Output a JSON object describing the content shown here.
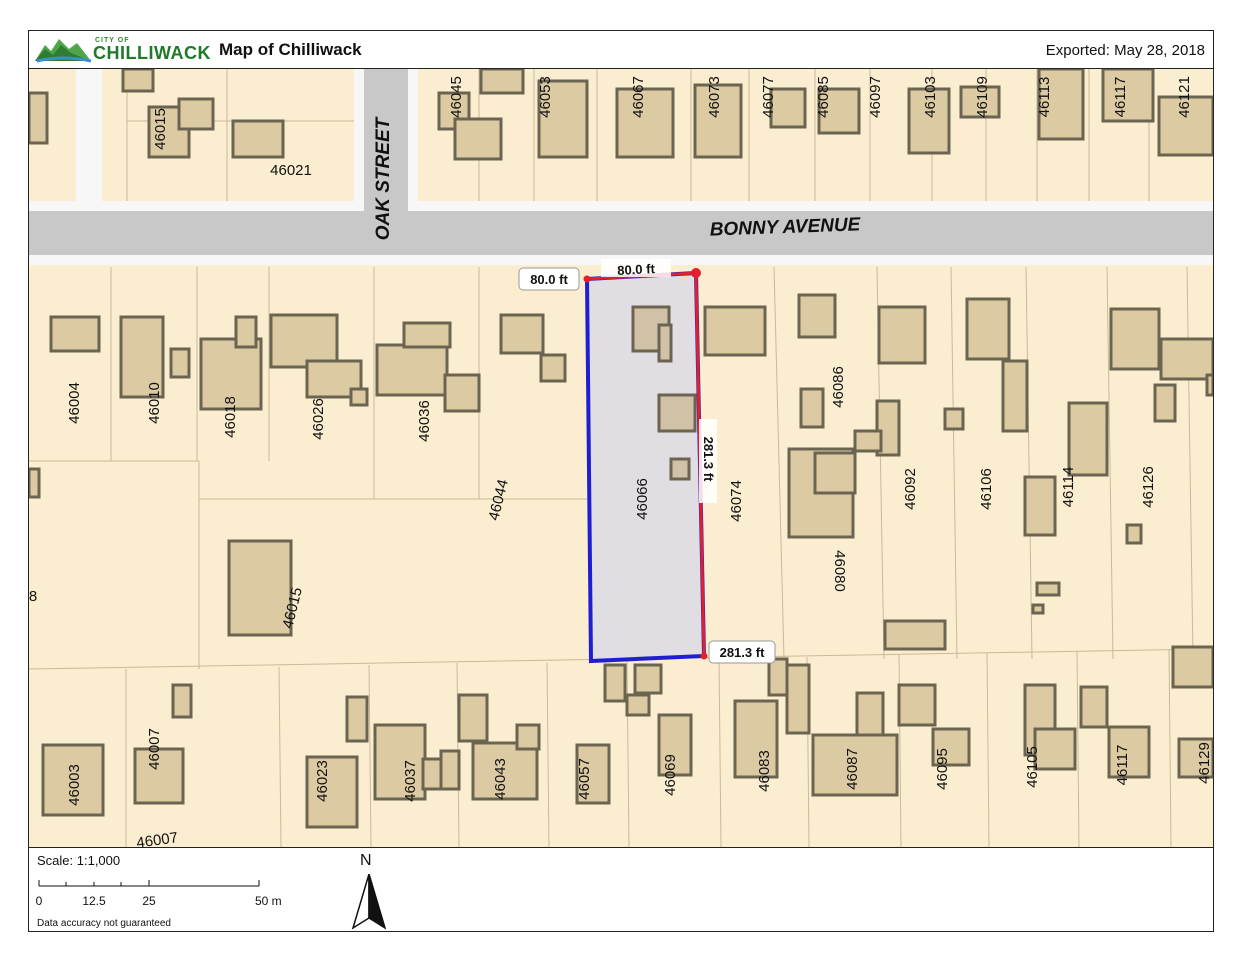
{
  "header": {
    "logo_small_text": "CITY OF",
    "logo_name": "CHILLIWACK",
    "title": "Map of Chilliwack",
    "exported": "Exported: May 28, 2018"
  },
  "streets": {
    "oak": "OAK STREET",
    "bonny": "BONNY AVENUE"
  },
  "addresses": {
    "a46015_n": "46015",
    "a46021": "46021",
    "a46045": "46045",
    "a46053": "46053",
    "a46067": "46067",
    "a46073": "46073",
    "a46077": "46077",
    "a46085": "46085",
    "a46097": "46097",
    "a46103": "46103",
    "a46109": "46109",
    "a46113": "46113",
    "a46117_n": "46117",
    "a46121": "46121",
    "a46004": "46004",
    "a46010": "46010",
    "a46018": "46018",
    "a46026": "46026",
    "a46036": "46036",
    "a46044": "46044",
    "a46066": "46066",
    "a46074": "46074",
    "a46086": "46086",
    "a46092": "46092",
    "a46106": "46106",
    "a46114": "46114",
    "a46126": "46126",
    "a46080": "46080",
    "a46015_s": "46015",
    "a_partial8": "8",
    "a46003": "46003",
    "a46007a": "46007",
    "a46007b": "46007",
    "a46023": "46023",
    "a46037": "46037",
    "a46043": "46043",
    "a46057": "46057",
    "a46069": "46069",
    "a46083": "46083",
    "a46087": "46087",
    "a46095": "46095",
    "a46105": "46105",
    "a46117_s": "46117",
    "a46129": "46129"
  },
  "measurements": {
    "width_label_box": "80.0 ft",
    "width_label_line": "80.0 ft",
    "depth_label_line": "281.3 ft",
    "depth_label_box": "281.3 ft"
  },
  "footer": {
    "scale": "Scale: 1:1,000",
    "ticks": [
      "0",
      "12.5",
      "25"
    ],
    "end_label": "50 m",
    "disclaimer": "Data accuracy not guaranteed",
    "north": "N"
  },
  "colors": {
    "parcel_fill": "#fbedcf",
    "road": "#c8c8c8",
    "building": "#dccaa3",
    "building_shadow": "#6b6450",
    "selected_parcel": "#1f1fd1",
    "measure_line": "#e0202c"
  }
}
